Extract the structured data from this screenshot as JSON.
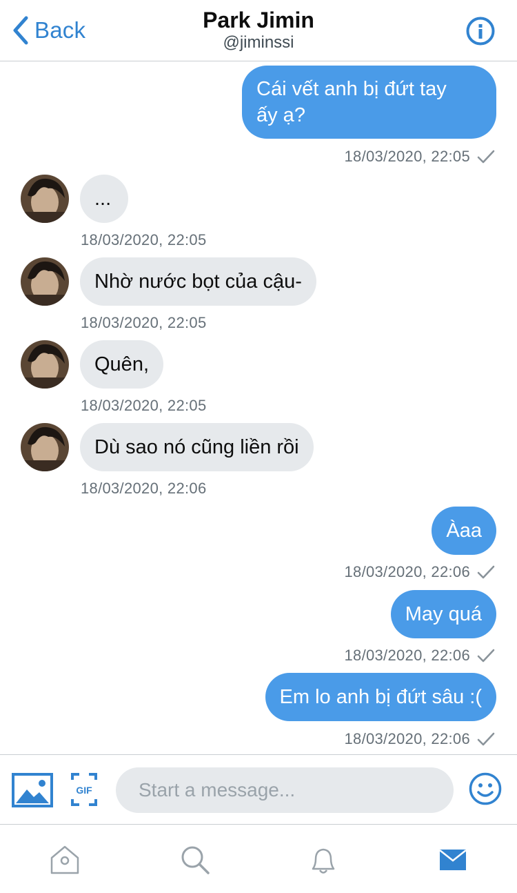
{
  "header": {
    "back_label": "Back",
    "title": "Park Jimin",
    "handle": "@jiminssi"
  },
  "composer": {
    "placeholder": "Start a message...",
    "gif_label": "GIF"
  },
  "colors": {
    "accent": "#4a9be8",
    "link": "#3183d0",
    "incoming_bubble": "#e6e9ec"
  },
  "messages": [
    {
      "direction": "out",
      "lines": [
        "Cái vết anh bị đứt tay",
        "ấy ạ?"
      ],
      "time": "18/03/2020, 22:05"
    },
    {
      "direction": "in",
      "text": "...",
      "time": "18/03/2020, 22:05"
    },
    {
      "direction": "in",
      "text": "Nhờ nước bọt của cậu-",
      "time": "18/03/2020, 22:05"
    },
    {
      "direction": "in",
      "text": "Quên,",
      "time": "18/03/2020, 22:05"
    },
    {
      "direction": "in",
      "text": "Dù sao nó cũng liền rồi",
      "time": "18/03/2020, 22:06"
    },
    {
      "direction": "out",
      "text": "Àaa",
      "time": "18/03/2020, 22:06"
    },
    {
      "direction": "out",
      "text": "May quá",
      "time": "18/03/2020, 22:06"
    },
    {
      "direction": "out",
      "text": "Em lo anh bị đứt sâu :(",
      "time": "18/03/2020, 22:06"
    }
  ],
  "tabs": [
    {
      "icon": "home-icon",
      "active": false
    },
    {
      "icon": "search-icon",
      "active": false
    },
    {
      "icon": "bell-icon",
      "active": false
    },
    {
      "icon": "mail-icon",
      "active": true
    }
  ]
}
